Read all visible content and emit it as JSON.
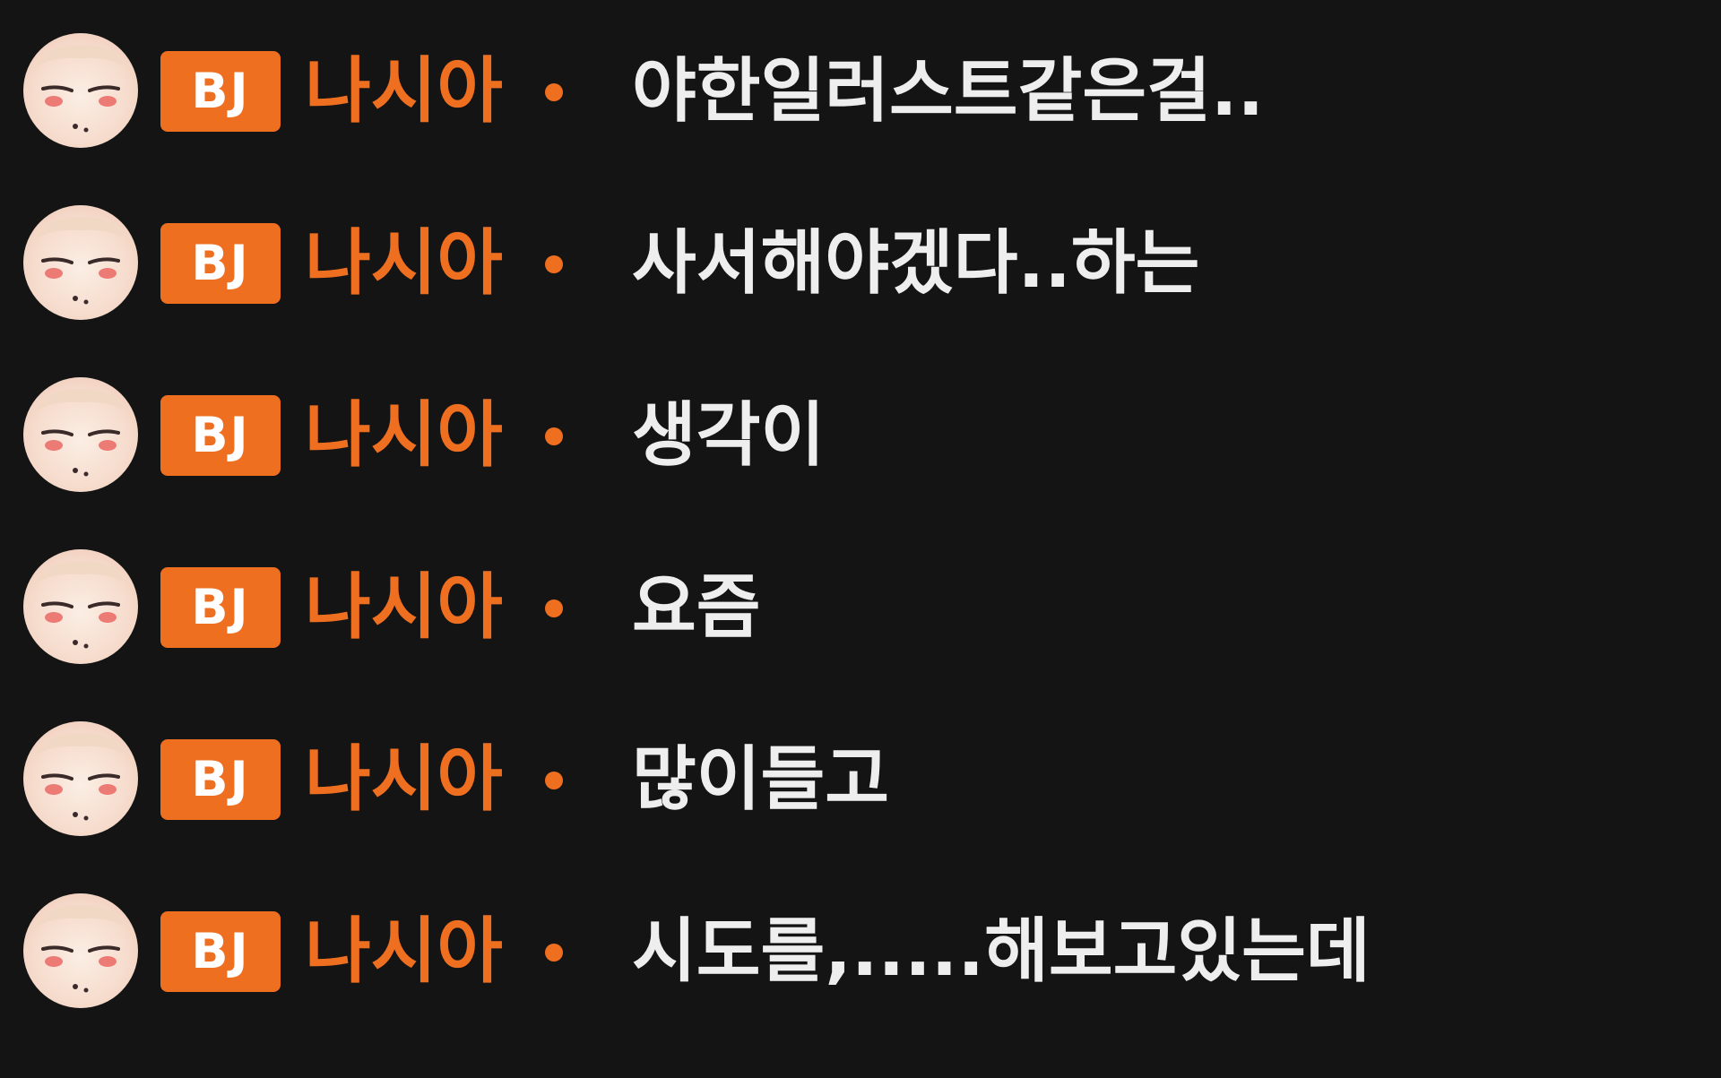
{
  "chat": {
    "messages": [
      {
        "badge": "BJ",
        "nickname": "나시아",
        "text": "야한일러스트같은걸.."
      },
      {
        "badge": "BJ",
        "nickname": "나시아",
        "text": "사서해야겠다..하는"
      },
      {
        "badge": "BJ",
        "nickname": "나시아",
        "text": "생각이"
      },
      {
        "badge": "BJ",
        "nickname": "나시아",
        "text": "요즘"
      },
      {
        "badge": "BJ",
        "nickname": "나시아",
        "text": "많이들고"
      },
      {
        "badge": "BJ",
        "nickname": "나시아",
        "text": "시도를,.....해보고있는데"
      }
    ]
  },
  "colors": {
    "background": "#141414",
    "accent": "#ef6f21",
    "message_text": "#eeeeee"
  },
  "icons": {
    "avatar": "user-avatar-icon"
  }
}
